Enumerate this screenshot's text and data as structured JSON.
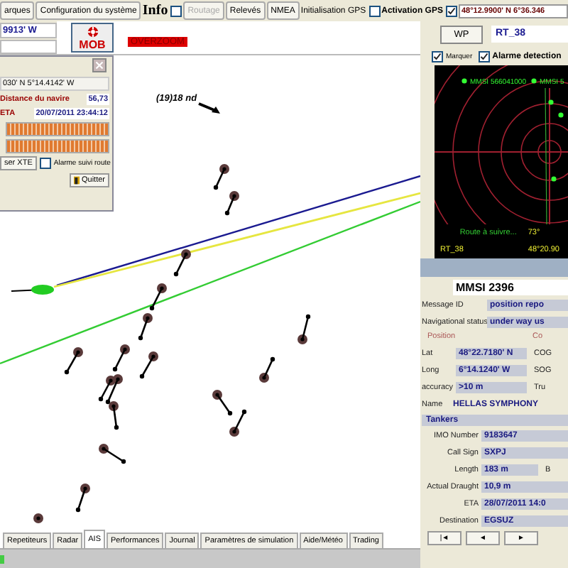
{
  "toolbar": [
    {
      "kind": "button",
      "label": "arques",
      "disabled": false
    },
    {
      "kind": "button",
      "label": "Configuration du système",
      "disabled": false
    },
    {
      "kind": "heading",
      "label": "Info",
      "checked": false
    },
    {
      "kind": "button",
      "label": "Routage",
      "disabled": true
    },
    {
      "kind": "button",
      "label": "Relevés",
      "disabled": false
    },
    {
      "kind": "button",
      "label": "NMEA",
      "disabled": false
    },
    {
      "kind": "checkbox",
      "label": "Initialisation GPS",
      "checked": false
    },
    {
      "kind": "strong",
      "label": "Activation GPS",
      "checked": true
    },
    {
      "kind": "field",
      "value": "48°12.9900' N  6°36.346"
    }
  ],
  "position_field": {
    "value": "9913' W"
  },
  "mob_button": {
    "label": "MOB"
  },
  "overzoom_label": "OVERZOOM",
  "route_dialog": {
    "position": "030' N  5°14.4142' W",
    "distance_label": "Distance du navire",
    "distance_value": "56,73",
    "eta_label": "ETA",
    "eta_value": "20/07/2011 23:44:12",
    "progress": [
      {
        "level": 1
      },
      {
        "level": 1
      }
    ],
    "xte_button": "ser XTE",
    "alarm": {
      "label": "Alarme suivi route",
      "checked": false
    },
    "quit_button": "Quitter"
  },
  "map": {
    "speed_label": "(19)18 nd"
  },
  "right_panel": {
    "wp_button": "WP",
    "route_field": "RT_38",
    "options": [
      {
        "label": "Marquer",
        "checked": true
      },
      {
        "label": "Alarme detection",
        "checked": true
      }
    ],
    "radar": {
      "targets": [
        "MMSI 566041000",
        "MMSI 5"
      ],
      "route_text": "Route à suivre...",
      "route_value": "73°",
      "route_name": "RT_38",
      "route_position": "48°20.90"
    }
  },
  "ais": {
    "mmsi": "MMSI 2396",
    "message_id": {
      "label": "Message ID",
      "value": "position repo"
    },
    "nav_status": {
      "label": "Navigational status",
      "value": "under way us"
    },
    "position_group": "Position",
    "course_group": "Co",
    "position_rows": [
      {
        "label": "Lat",
        "value": "48°22.7180' N",
        "side": "COG"
      },
      {
        "label": "Long",
        "value": "6°14.1240' W",
        "side": "SOG"
      },
      {
        "label": "accuracy",
        "value": ">10 m",
        "side": "Tru"
      }
    ],
    "name": {
      "label": "Name",
      "value": "HELLAS SYMPHONY"
    },
    "type": "Tankers",
    "details": [
      {
        "label": "IMO Number",
        "value": "9183647"
      },
      {
        "label": "Call Sign",
        "value": "SXPJ"
      },
      {
        "label": "Length",
        "value": "183 m",
        "side": "B"
      },
      {
        "label": "Actual Draught",
        "value": "10,9 m"
      },
      {
        "label": "ETA",
        "value": "28/07/2011 14:0"
      },
      {
        "label": "Destination",
        "value": "EGSUZ"
      }
    ],
    "nav_buttons": [
      "|◄",
      "◄",
      "►"
    ]
  },
  "tabs": [
    {
      "label": "Repetiteurs",
      "selected": false
    },
    {
      "label": "Radar",
      "selected": false
    },
    {
      "label": "AIS",
      "selected": true
    },
    {
      "label": "Performances",
      "selected": false
    },
    {
      "label": "Journal",
      "selected": false
    },
    {
      "label": "Paramètres de simulation",
      "selected": false
    },
    {
      "label": "Aide/Météo",
      "selected": false
    },
    {
      "label": "Trading",
      "selected": false
    }
  ]
}
